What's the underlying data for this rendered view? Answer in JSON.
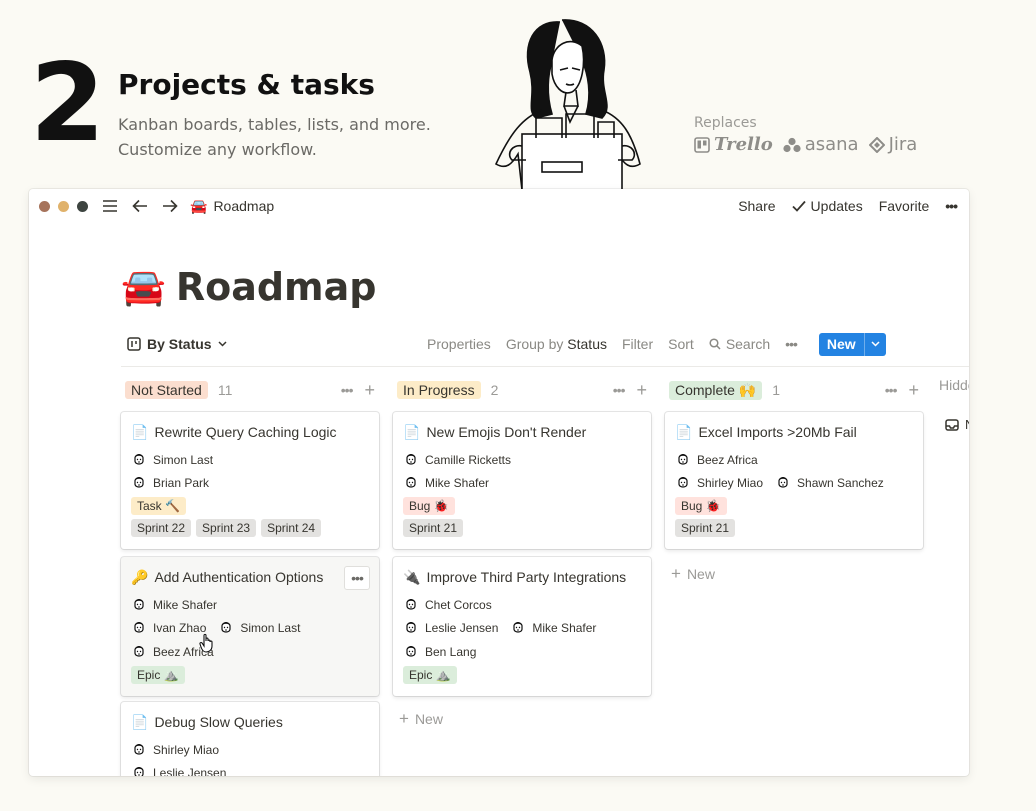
{
  "hero": {
    "number": "2",
    "title": "Projects & tasks",
    "subtitle_line1": "Kanban boards, tables, lists, and more.",
    "subtitle_line2": "Customize any workflow.",
    "replaces_label": "Replaces",
    "logos": [
      {
        "name": "Trello",
        "icon": "trello-icon"
      },
      {
        "name": "asana",
        "icon": "asana-icon"
      },
      {
        "name": "Jira",
        "icon": "jira-icon"
      }
    ]
  },
  "window": {
    "traffic_colors": [
      "#a6735b",
      "#e0b26b",
      "#3d4440"
    ],
    "breadcrumb_emoji": "🚘",
    "breadcrumb": "Roadmap",
    "share": "Share",
    "updates": "Updates",
    "favorite": "Favorite",
    "more": "•••"
  },
  "page": {
    "emoji": "🚘",
    "title": "Roadmap"
  },
  "viewbar": {
    "view_name": "By Status",
    "properties": "Properties",
    "group_by_prefix": "Group by",
    "group_by_value": "Status",
    "filter": "Filter",
    "sort": "Sort",
    "search": "Search",
    "more": "•••",
    "new_label": "New"
  },
  "columns": [
    {
      "status": "Not Started",
      "count": "11",
      "bg": "#fbdecf",
      "cards": [
        {
          "icon": "📄",
          "title": "Rewrite Query Caching Logic",
          "people": [
            [
              "Simon Last"
            ],
            [
              "Brian Park"
            ]
          ],
          "tags": [
            {
              "label": "Task 🔨",
              "kind": "task"
            }
          ],
          "sprints": [
            "Sprint 22",
            "Sprint 23",
            "Sprint 24"
          ]
        },
        {
          "icon": "🔑",
          "title": "Add Authentication Options",
          "people": [
            [
              "Mike Shafer"
            ],
            [
              "Ivan Zhao",
              "Simon Last"
            ],
            [
              "Beez Africa"
            ]
          ],
          "tags": [
            {
              "label": "Epic ⛰️",
              "kind": "epic"
            }
          ],
          "sprints": []
        },
        {
          "icon": "📄",
          "title": "Debug Slow Queries",
          "people": [
            [
              "Shirley Miao"
            ],
            [
              "Leslie Jensen"
            ]
          ],
          "tags": [],
          "sprints": []
        }
      ]
    },
    {
      "status": "In Progress",
      "count": "2",
      "bg": "#fdecc8",
      "cards": [
        {
          "icon": "📄",
          "title": "New Emojis Don't Render",
          "people": [
            [
              "Camille Ricketts"
            ],
            [
              "Mike Shafer"
            ]
          ],
          "tags": [
            {
              "label": "Bug 🐞",
              "kind": "bug"
            }
          ],
          "sprints": [
            "Sprint 21"
          ]
        },
        {
          "icon": "🔌",
          "title": "Improve Third Party Integrations",
          "people": [
            [
              "Chet Corcos"
            ],
            [
              "Leslie Jensen",
              "Mike Shafer"
            ],
            [
              "Ben Lang"
            ]
          ],
          "tags": [
            {
              "label": "Epic ⛰️",
              "kind": "epic"
            }
          ],
          "sprints": []
        }
      ],
      "new_label": "New"
    },
    {
      "status": "Complete 🙌",
      "count": "1",
      "bg": "#dbeddb",
      "cards": [
        {
          "icon": "📄",
          "title": "Excel Imports >20Mb Fail",
          "people": [
            [
              "Beez Africa"
            ],
            [
              "Shirley Miao",
              "Shawn Sanchez"
            ]
          ],
          "tags": [
            {
              "label": "Bug 🐞",
              "kind": "bug"
            }
          ],
          "sprints": [
            "Sprint 21"
          ]
        }
      ],
      "new_label": "New"
    }
  ],
  "hidden_label": "Hidden",
  "hidden_item_initial": "N",
  "colors": {
    "accent": "#2383e2",
    "text": "#37352f",
    "muted": "#9b9a97"
  }
}
